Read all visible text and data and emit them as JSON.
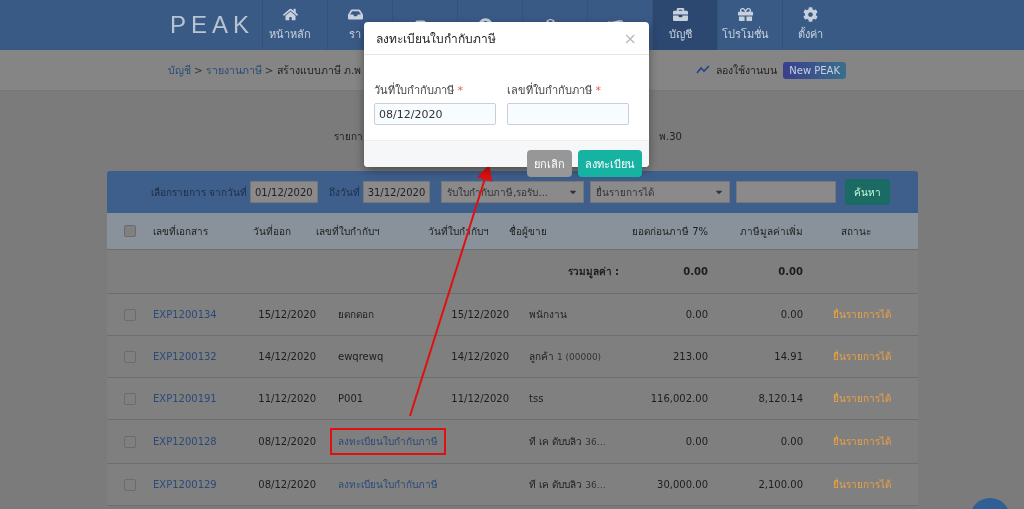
{
  "nav": {
    "logo": "PEAK",
    "items": [
      {
        "label": "หน้าหลัก",
        "selected": false
      },
      {
        "label": "รา",
        "selected": false
      },
      {
        "selected": false
      },
      {
        "selected": false
      },
      {
        "selected": false
      },
      {
        "selected": false
      },
      {
        "label": "บัญชี",
        "selected": true
      },
      {
        "label": "โปรโมชั่น",
        "selected": false
      },
      {
        "label": "ตั้งค่า",
        "selected": false
      }
    ]
  },
  "breadcrumb": {
    "separator": ">",
    "items": [
      {
        "label": "บัญชี",
        "kind": "link"
      },
      {
        "label": "รายงานภาษี",
        "kind": "link"
      },
      {
        "label": "สร้างแบบภาษี ภ.พ",
        "kind": "current"
      }
    ]
  },
  "try_new": {
    "label": "ลองใช้งานบน",
    "badge": "New PEAK"
  },
  "summary_fragments": {
    "left": "รายกา",
    "right": "พ.30"
  },
  "filter": {
    "label": "เลือกรายการ",
    "from_label": "จากวันที่",
    "from": "01/12/2020",
    "to_label": "ถึงวันที่",
    "to": "31/12/2020",
    "status_select": "รับใบกำกับภาษี,รอรับ...",
    "filing_select": "ยื่นรายการได้",
    "search_button": "ค้นหา"
  },
  "table": {
    "all_checked": false,
    "columns": [
      "เลขที่เอกสาร",
      "วันที่ออก",
      "เลขที่ใบกำกับฯ",
      "วันที่ใบกำกับฯ",
      "ชื่อผู้ขาย",
      "ยอดก่อนภาษี 7%",
      "ภาษีมูลค่าเพิ่ม",
      "สถานะ"
    ],
    "total": {
      "label": "รวมมูลค่า :",
      "pre_tax": "0.00",
      "vat": "0.00"
    },
    "rows": [
      {
        "checked": false,
        "doc_no": "EXP1200134",
        "issue_date": "15/12/2020",
        "tax_no": "ยดกดอก",
        "tax_no_link": false,
        "highlighted": false,
        "tax_date": "15/12/2020",
        "seller": "พนักงาน",
        "pre_tax": "0.00",
        "vat": "0.00",
        "status": "ยื่นรายการได้"
      },
      {
        "checked": false,
        "doc_no": "EXP1200132",
        "issue_date": "14/12/2020",
        "tax_no": "ewqrewq",
        "tax_no_link": false,
        "highlighted": false,
        "tax_date": "14/12/2020",
        "seller": "ลูกค้า",
        "seller_note": "1 (00000)",
        "pre_tax": "213.00",
        "vat": "14.91",
        "status": "ยื่นรายการได้"
      },
      {
        "checked": false,
        "doc_no": "EXP1200191",
        "issue_date": "11/12/2020",
        "tax_no": "P001",
        "tax_no_link": false,
        "highlighted": false,
        "tax_date": "11/12/2020",
        "seller": "tss",
        "pre_tax": "116,002.00",
        "vat": "8,120.14",
        "status": "ยื่นรายการได้"
      },
      {
        "checked": false,
        "doc_no": "EXP1200128",
        "issue_date": "08/12/2020",
        "tax_no": "ลงทะเบียนใบกำกับภาษี",
        "tax_no_link": true,
        "highlighted": true,
        "seller": "ที เค ดับบลิว",
        "seller_note": "36…",
        "pre_tax": "0.00",
        "vat": "0.00",
        "status": "ยื่นรายการได้"
      },
      {
        "checked": false,
        "doc_no": "EXP1200129",
        "issue_date": "08/12/2020",
        "tax_no": "ลงทะเบียนใบกำกับภาษี",
        "tax_no_link": true,
        "highlighted": false,
        "seller": "ที เค ดับบลิว",
        "seller_note": "36…",
        "pre_tax": "30,000.00",
        "vat": "2,100.00",
        "status": "ยื่นรายการได้"
      }
    ]
  },
  "modal": {
    "title": "ลงทะเบียนใบกำกับภาษี",
    "close": "×",
    "required_mark": "*",
    "fields": [
      {
        "label": "วันที่ใบกำกับภาษี",
        "required": true,
        "value": "08/12/2020"
      },
      {
        "label": "เลขที่ใบกำกับภาษี",
        "required": true
      }
    ],
    "buttons": [
      {
        "label": "ยกเลิก",
        "kind": "secondary"
      },
      {
        "label": "ลงทะเบียน",
        "kind": "primary"
      }
    ]
  }
}
